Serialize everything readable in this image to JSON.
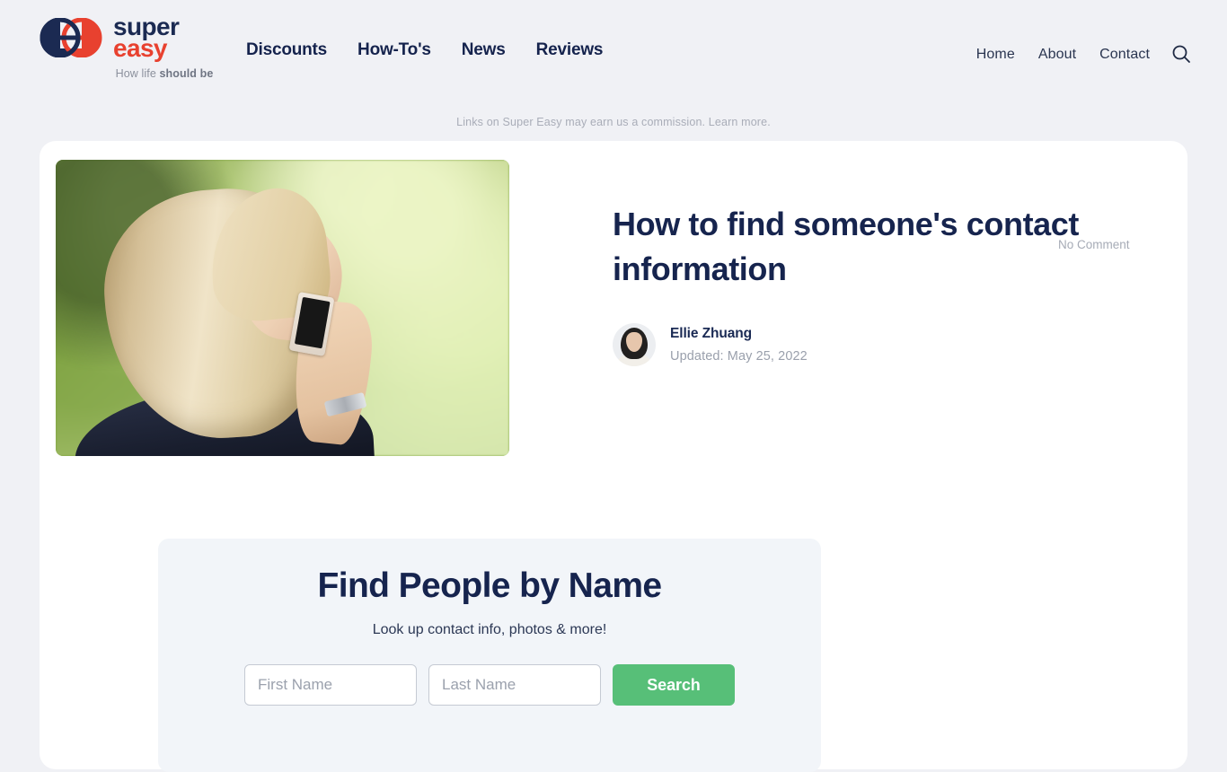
{
  "brand": {
    "name_line1": "super",
    "name_line2": "easy",
    "tagline_prefix": "How life ",
    "tagline_bold": "should be",
    "logo_icon": "superzeasy-double-e-logo",
    "navy": "#1b2a52",
    "red": "#e8412f"
  },
  "nav": {
    "primary": [
      {
        "label": "Discounts"
      },
      {
        "label": "How-To's"
      },
      {
        "label": "News"
      },
      {
        "label": "Reviews"
      }
    ],
    "secondary": [
      {
        "label": "Home"
      },
      {
        "label": "About"
      },
      {
        "label": "Contact"
      }
    ],
    "search_icon": "search-icon"
  },
  "disclaimer": {
    "text": "Links on Super Easy may earn us a commission.",
    "link_label": "Learn more."
  },
  "article": {
    "title": "How to find someone's contact information",
    "hero_image_alt": "Blonde woman talking on a mobile phone outdoors",
    "author": "Ellie Zhuang",
    "updated": "Updated: May 25, 2022",
    "comments": "No Comment"
  },
  "widget": {
    "title": "Find People by Name",
    "subtitle": "Look up contact info, photos & more!",
    "first_name_placeholder": "First Name",
    "first_name_value": "",
    "last_name_placeholder": "Last Name",
    "last_name_value": "",
    "search_label": "Search",
    "accent_color": "#57bf78"
  }
}
